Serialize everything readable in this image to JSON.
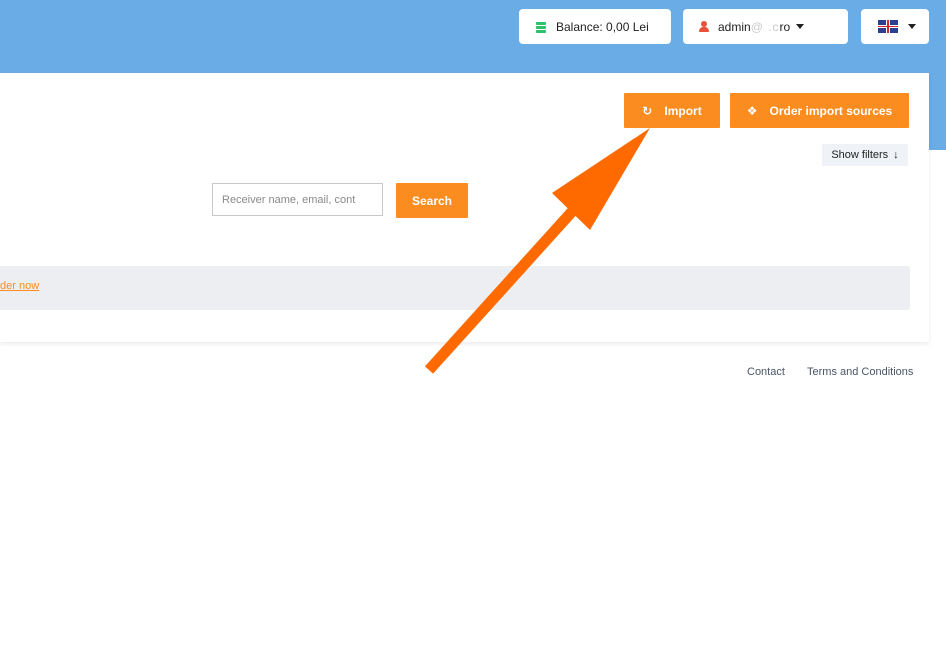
{
  "header": {
    "balance_label": "Balance: 0,00 Lei",
    "account_visible": "admin",
    "account_obscured": "@  .c",
    "account_suffix": "ro",
    "language_icon": "uk-flag-icon"
  },
  "toolbar": {
    "import_label": "Import",
    "import_icon": "sync-icon",
    "order_sources_label": "Order import sources",
    "order_sources_icon": "cubes-icon",
    "show_filters_label": "Show filters",
    "show_filters_icon": "arrow-down-icon"
  },
  "search": {
    "placeholder": "Receiver name, email, cont",
    "button_label": "Search"
  },
  "notice": {
    "link_text": "der now"
  },
  "footer": {
    "contact": "Contact",
    "terms": "Terms and Conditions"
  },
  "colors": {
    "header_bg": "#6aace6",
    "accent": "#fb8c1f",
    "annotation_arrow": "#ff6a00"
  }
}
